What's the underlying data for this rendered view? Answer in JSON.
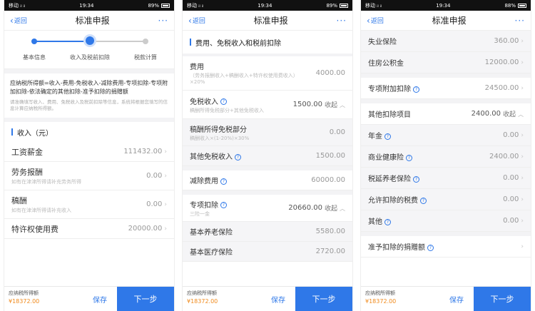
{
  "status": {
    "carrier": "移动 ᵢₗ ᵢₗ",
    "time": "19:34",
    "battery": "89%",
    "battery3": "88%"
  },
  "nav": {
    "back": "返回",
    "title": "标准申报",
    "more": "···"
  },
  "footer": {
    "label": "应纳税所得额",
    "amount": "¥18372.00",
    "save": "保存",
    "next": "下一步"
  },
  "screen1": {
    "steps": [
      "基本信息",
      "收入及税前扣除",
      "税款计算"
    ],
    "note_main": "应纳税所得额=收入-费用-免税收入-减除费用-专项扣除-专项附加扣除-依法确定的其他扣除-准予扣除的捐赠额",
    "note_sub": "请准确填写收入、费用、免税收入及税前扣除等信息，系统将根据您填写的信息计算应纳税所得额。",
    "section": "收入（元）",
    "items": [
      {
        "label": "工资薪金",
        "value": "111432.00",
        "sub": ""
      },
      {
        "label": "劳务报酬",
        "value": "0.00",
        "sub": "如有在津津所得请补充劳务所得"
      },
      {
        "label": "稿酬",
        "value": "0.00",
        "sub": "如有在津津所得请补充收入"
      },
      {
        "label": "特许权使用费",
        "value": "20000.00",
        "sub": ""
      }
    ]
  },
  "screen2": {
    "section": "费用、免税收入和税前扣除",
    "fee_label": "费用",
    "fee_sub": "（劳务报酬收入+稿酬收入+特许权使用费收入）×20%",
    "fee_value": "4000.00",
    "exempt_label": "免税收入",
    "exempt_sub": "稿酬所得免税部分+其他免税收入",
    "exempt_value": "1500.00",
    "collapse": "收起",
    "royalty_label": "稿酬所得免税部分",
    "royalty_sub": "稿酬收入×(1-20%)×30%",
    "royalty_value": "0.00",
    "other_exempt_label": "其他免税收入",
    "other_exempt_value": "1500.00",
    "deduct_label": "减除费用",
    "deduct_value": "60000.00",
    "special_label": "专项扣除",
    "special_sub": "三险一金",
    "special_value": "20660.00",
    "pension_label": "基本养老保险",
    "pension_value": "5580.00",
    "medical_label": "基本医疗保险",
    "medical_value": "2720.00"
  },
  "screen3": {
    "unemp_label": "失业保险",
    "unemp_value": "360.00",
    "housing_label": "住房公积金",
    "housing_value": "12000.00",
    "addl_label": "专项附加扣除",
    "addl_value": "24500.00",
    "other_label": "其他扣除项目",
    "other_value": "2400.00",
    "collapse": "收起",
    "items": [
      {
        "label": "年金",
        "value": "0.00"
      },
      {
        "label": "商业健康险",
        "value": "2400.00"
      },
      {
        "label": "税延养老保险",
        "value": "0.00"
      },
      {
        "label": "允许扣除的税费",
        "value": "0.00"
      },
      {
        "label": "其他",
        "value": "0.00"
      }
    ],
    "donation_label": "准予扣除的捐赠额",
    "donation_value": ""
  }
}
